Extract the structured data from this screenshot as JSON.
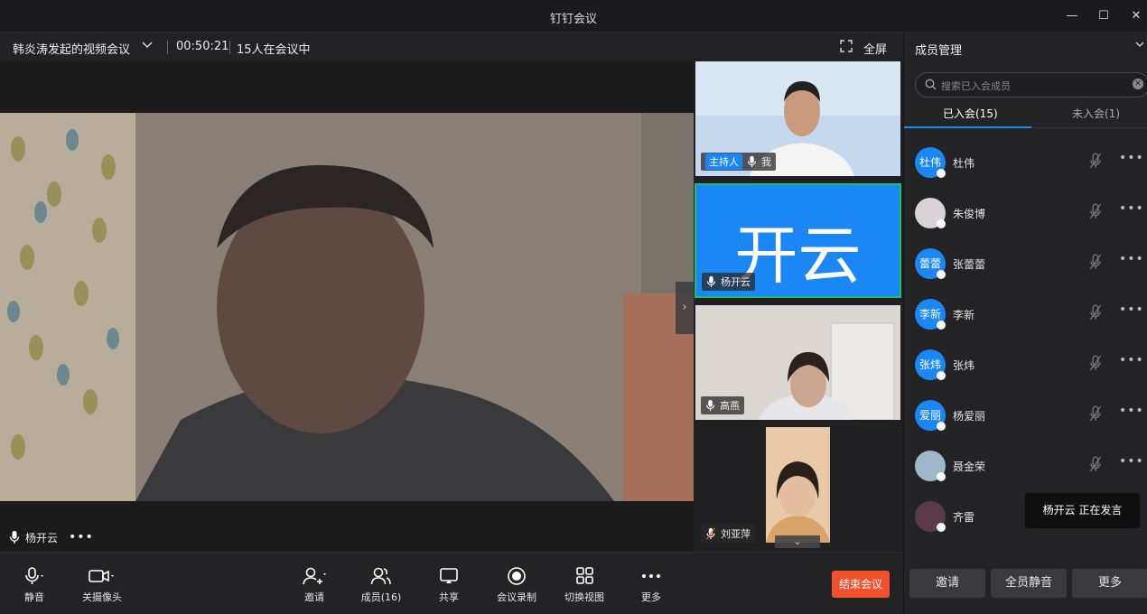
{
  "window": {
    "title": "钉钉会议",
    "minimize": "—",
    "maximize": "☐",
    "close": "✕"
  },
  "meeting": {
    "title": "韩炎涛发起的视频会议",
    "timer": "00:50:21",
    "participants_text": "15人在会议中",
    "fullscreen_label": "全屏"
  },
  "main_video": {
    "speaker_name": "杨开云",
    "more": "•••"
  },
  "tiles": [
    {
      "host_badge": "主持人",
      "name": "我"
    },
    {
      "avatar_text": "开云",
      "name": "杨开云",
      "highlight_color": "#1a87f5"
    },
    {
      "name": "高燕"
    },
    {
      "name": "刘亚萍",
      "muted": true
    }
  ],
  "toolbar": {
    "mute": "静音",
    "camera_off": "关摄像头",
    "invite": "邀请",
    "members": "成员(16)",
    "share": "共享",
    "record": "会议录制",
    "switch_view": "切换视图",
    "more": "更多",
    "end_meeting": "结束会议"
  },
  "panel": {
    "title": "成员管理",
    "search_placeholder": "搜索已入会成员",
    "tab_joined": "已入会(15)",
    "tab_not_joined": "未入会(1)",
    "members": [
      {
        "name": "杜伟",
        "avatar": "杜伟"
      },
      {
        "name": "朱俊博",
        "avatar": ""
      },
      {
        "name": "张蕾蕾",
        "avatar": "蕾蕾"
      },
      {
        "name": "李新",
        "avatar": "李新"
      },
      {
        "name": "张炜",
        "avatar": "张炜"
      },
      {
        "name": "杨爱丽",
        "avatar": "爱丽"
      },
      {
        "name": "聂金荣",
        "avatar": ""
      },
      {
        "name": "齐雷",
        "avatar": ""
      }
    ],
    "tooltip": "杨开云  正在发言",
    "btn_invite": "邀请",
    "btn_mute_all": "全员静音",
    "btn_more": "更多"
  },
  "colors": {
    "accent": "#1a87f5",
    "end": "#f1522d",
    "tile_highlight": "#1fbf6b"
  }
}
